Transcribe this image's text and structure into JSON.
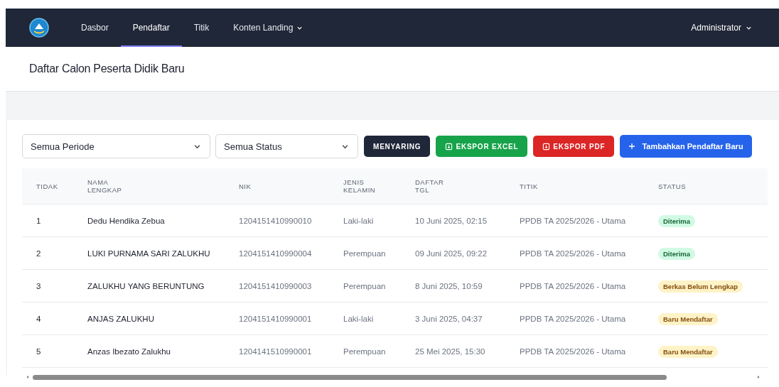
{
  "nav": {
    "items": [
      {
        "label": "Dasbor",
        "selected": false,
        "dropdown": false
      },
      {
        "label": "Pendaftar",
        "selected": true,
        "dropdown": false
      },
      {
        "label": "Titik",
        "selected": false,
        "dropdown": false
      },
      {
        "label": "Konten Landing",
        "selected": false,
        "dropdown": true
      }
    ],
    "user": "Administrator"
  },
  "page_title": "Daftar Calon Peserta Didik Baru",
  "filters": {
    "period": "Semua Periode",
    "status": "Semua Status"
  },
  "buttons": [
    {
      "label": "MENYARING",
      "kind": "filter"
    },
    {
      "label": "EKSPOR EXCEL",
      "kind": "excel"
    },
    {
      "label": "EKSPOR PDF",
      "kind": "pdf"
    },
    {
      "label": "Tambahkan Pendaftar Baru",
      "kind": "add"
    }
  ],
  "table": {
    "columns": [
      "TIDAK",
      "NAMA LENGKAP",
      "NIK",
      "JENIS KELAMIN",
      "DAFTAR TGL",
      "TITIK",
      "STATUS"
    ],
    "rows": [
      {
        "no": "1",
        "name": "Dedu Hendika Zebua",
        "nik": "1204151410990010",
        "gender": "Laki-laki",
        "date": "10 Juni 2025, 02:15",
        "point": "PPDB TA 2025/2026 - Utama",
        "status": "Diterima",
        "kind": "success"
      },
      {
        "no": "2",
        "name": "LUKI PURNAMA SARI ZALUKHU",
        "nik": "1204151410990004",
        "gender": "Perempuan",
        "date": "09 Juni 2025, 09:22",
        "point": "PPDB TA 2025/2026 - Utama",
        "status": "Diterima",
        "kind": "success"
      },
      {
        "no": "3",
        "name": "ZALUKHU YANG BERUNTUNG",
        "nik": "1204151410990003",
        "gender": "Perempuan",
        "date": "8 Juni 2025, 10:59",
        "point": "PPDB TA 2025/2026 - Utama",
        "status": "Berkas Belum Lengkap",
        "kind": "warning"
      },
      {
        "no": "4",
        "name": "ANJAS ZALUKHU",
        "nik": "1204151410990001",
        "gender": "Laki-laki",
        "date": "3 Juni 2025, 04:37",
        "point": "PPDB TA 2025/2026 - Utama",
        "status": "Baru Mendaftar",
        "kind": "warning"
      },
      {
        "no": "5",
        "name": "Anzas Ibezato Zalukhu",
        "nik": "1204141510990001",
        "gender": "Perempuan",
        "date": "25 Mei 2025, 15:30",
        "point": "PPDB TA 2025/2026 - Utama",
        "status": "Baru Mendaftar",
        "kind": "warning"
      }
    ]
  }
}
